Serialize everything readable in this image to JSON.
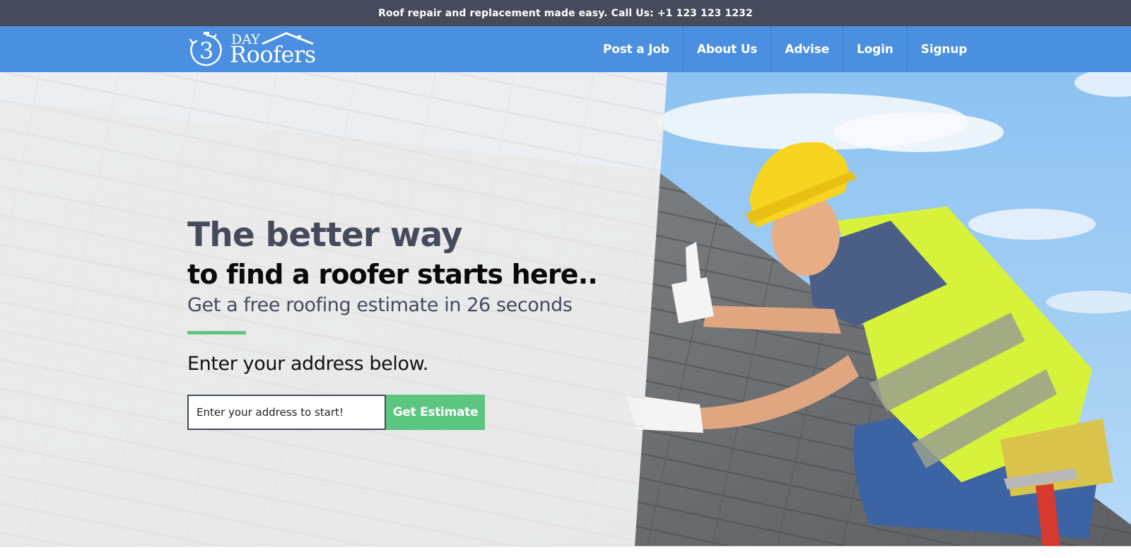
{
  "topbar": {
    "message": "Roof repair and replacement made easy. Call Us: +1 123 123 1232"
  },
  "logo": {
    "number": "3",
    "day": "DAY",
    "name": "Roofers"
  },
  "nav": {
    "items": [
      {
        "label": "Post a Job"
      },
      {
        "label": "About Us"
      },
      {
        "label": "Advise"
      },
      {
        "label": "Login"
      },
      {
        "label": "Signup"
      }
    ]
  },
  "hero": {
    "heading": "The better way",
    "subheading": "to find a roofer starts here..",
    "tagline": "Get a free roofing estimate in 26 seconds",
    "prompt": "Enter your address below.",
    "address_placeholder": "Enter your address to start!",
    "button_label": "Get Estimate"
  },
  "colors": {
    "topbar_bg": "#454b5a",
    "navbar_bg": "#4a8fe0",
    "accent_green": "#5cc57f",
    "heading_gray": "#454b5a",
    "vest_yellow": "#d6f23a",
    "helmet_yellow": "#f6d41f"
  },
  "icons": [
    "stopwatch-icon",
    "house-roof-icon"
  ]
}
